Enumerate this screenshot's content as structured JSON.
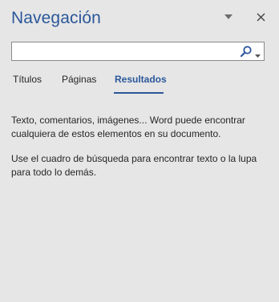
{
  "panel": {
    "title": "Navegación",
    "menu_icon": "triangle-down-icon",
    "close_icon": "close-icon"
  },
  "search": {
    "value": "",
    "placeholder": "",
    "search_icon": "magnifier-icon",
    "dropdown_icon": "caret-down-icon"
  },
  "tabs": [
    {
      "label": "Títulos",
      "active": false
    },
    {
      "label": "Páginas",
      "active": false
    },
    {
      "label": "Resultados",
      "active": true
    }
  ],
  "results": {
    "message_1": "Texto, comentarios, imágenes... Word puede encontrar cualquiera de estos elementos en su documento.",
    "message_2": "Use el cuadro de búsqueda para encontrar texto o la lupa para todo lo demás."
  },
  "colors": {
    "accent": "#2b579a",
    "background": "#e6e6e6",
    "text": "#262626"
  }
}
